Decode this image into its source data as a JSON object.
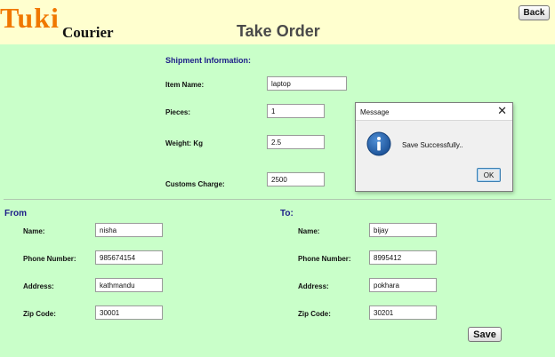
{
  "header": {
    "brand_primary": "Tuki",
    "brand_secondary": "Courier",
    "title": "Take Order",
    "back_label": "Back"
  },
  "shipment": {
    "heading": "Shipment Information:",
    "item_name": {
      "label": "Item Name:",
      "value": "laptop"
    },
    "pieces": {
      "label": "Pieces:",
      "value": "1"
    },
    "weight": {
      "label": "Weight: Kg",
      "value": "2.5"
    },
    "customs": {
      "label": "Customs Charge:",
      "value": "2500"
    }
  },
  "from": {
    "heading": "From",
    "name": {
      "label": "Name:",
      "value": "nisha"
    },
    "phone": {
      "label": "Phone Number:",
      "value": "985674154"
    },
    "address": {
      "label": "Address:",
      "value": "kathmandu"
    },
    "zip": {
      "label": "Zip Code:",
      "value": "30001"
    }
  },
  "to": {
    "heading": "To:",
    "name": {
      "label": "Name:",
      "value": "bijay"
    },
    "phone": {
      "label": "Phone Number:",
      "value": "8995412"
    },
    "address": {
      "label": "Address:",
      "value": "pokhara"
    },
    "zip": {
      "label": "Zip Code:",
      "value": "30201"
    }
  },
  "save_label": "Save",
  "dialog": {
    "title": "Message",
    "close_glyph": "✕",
    "icon": "info-icon",
    "message": "Save Successfully..",
    "ok_label": "OK"
  },
  "colors": {
    "background": "#c9ffc9",
    "header_background": "#ffffcf",
    "brand_orange": "#f07800",
    "section_heading": "#1c1c88",
    "info_blue": "#1e5fa8"
  }
}
